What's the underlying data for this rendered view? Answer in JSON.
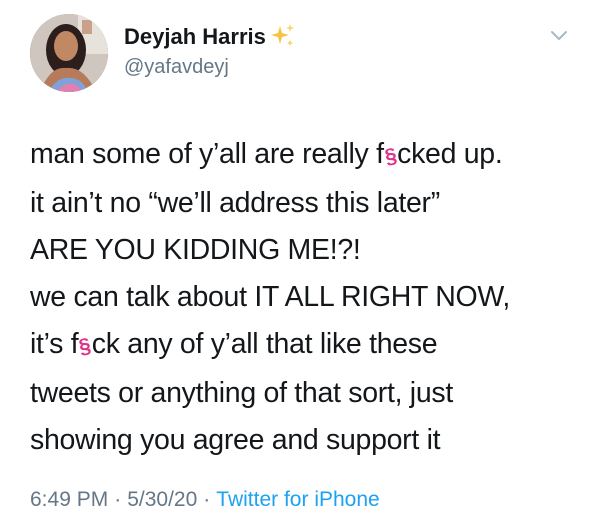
{
  "tweet": {
    "display_name": "Deyjah Harris",
    "handle": "@yafavdeyj",
    "lines": {
      "l1_a": "man some of y’all are really f",
      "l1_censor": "§",
      "l1_b": "cked up.",
      "l2": "it ain’t no “we’ll address this later”",
      "l3": "ARE YOU KIDDING ME!?!",
      "l4": "we can talk about IT ALL RIGHT NOW,",
      "l5_a": "it’s f",
      "l5_censor": "§",
      "l5_b": "ck any of y’all that like these",
      "l6": "tweets or anything of that sort, just",
      "l7": "showing you agree and support it"
    },
    "time": "6:49 PM",
    "date": "5/30/20",
    "separator": "·",
    "source": "Twitter for iPhone"
  },
  "colors": {
    "name": "#14171a",
    "muted": "#657786",
    "link": "#1da1f2",
    "censor": "#e0338a",
    "sparkle": "#f5c542"
  },
  "icons": {
    "sparkle": "sparkles-emoji",
    "chevron": "chevron-down-icon"
  }
}
